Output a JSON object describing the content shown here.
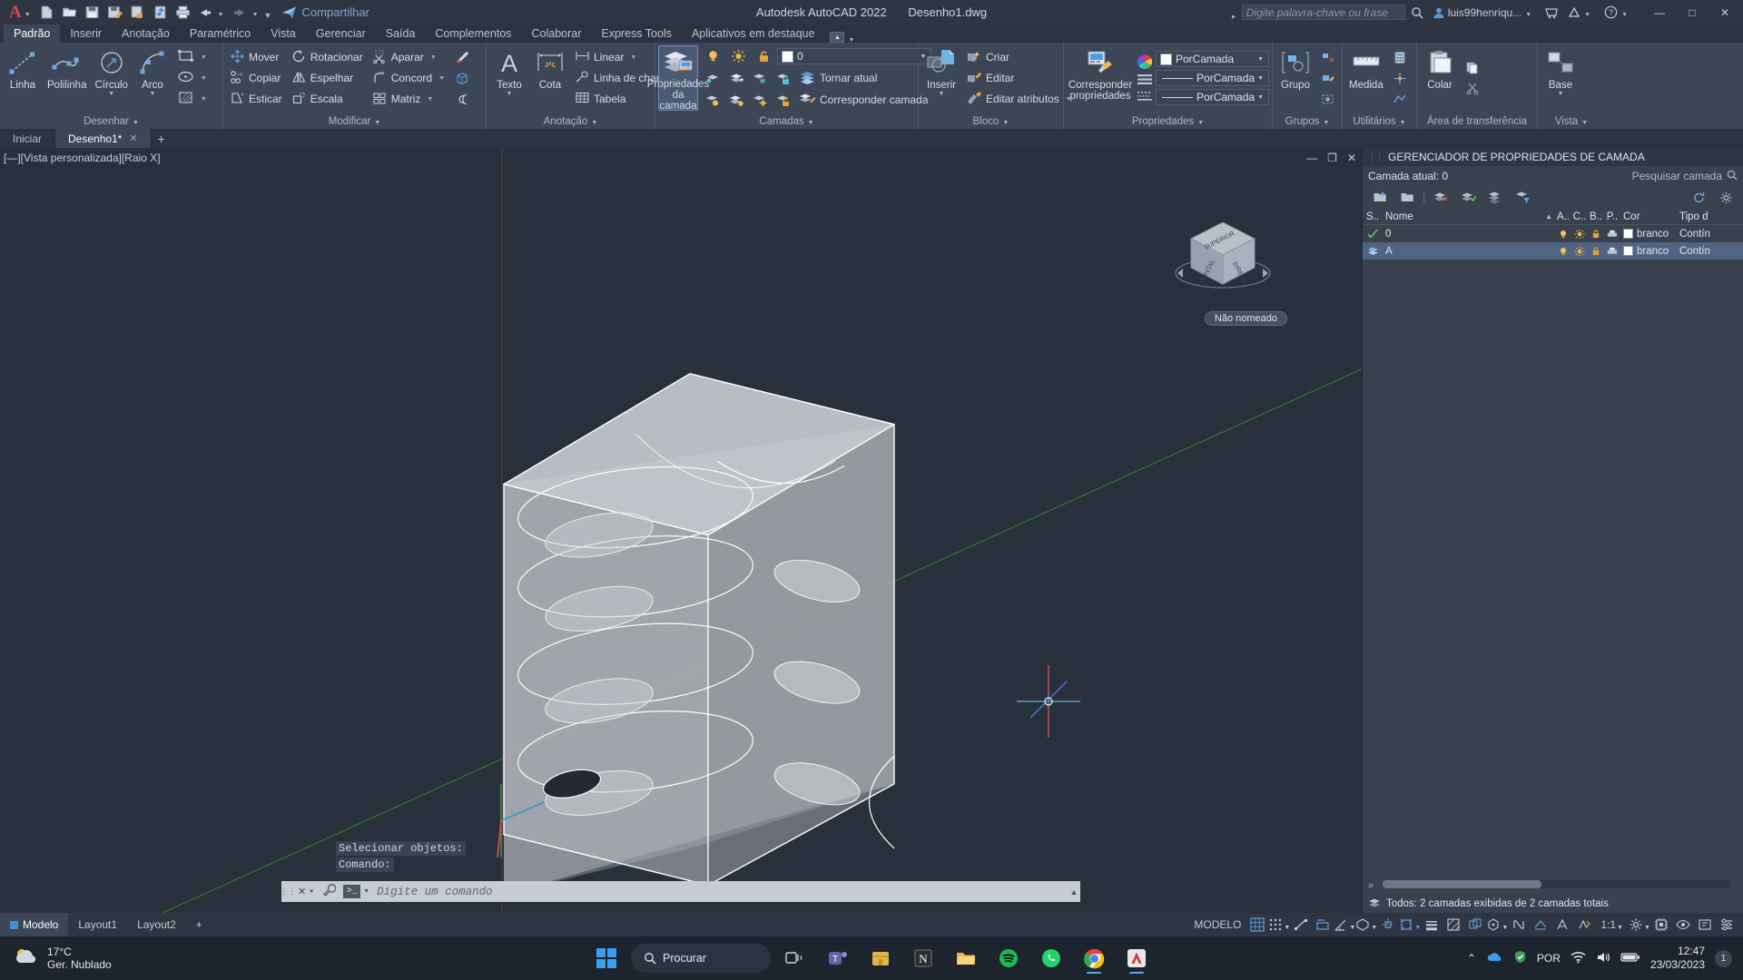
{
  "titlebar": {
    "app_menu": "A",
    "quick_access": [
      "new-icon",
      "open-icon",
      "save-icon",
      "save-as-icon",
      "plot-preview-icon",
      "sync-icon",
      "print-icon",
      "undo-icon",
      "redo-icon",
      "customize-icon"
    ],
    "share_label": "Compartilhar",
    "app_name": "Autodesk AutoCAD 2022",
    "file_name": "Desenho1.dwg",
    "search_placeholder": "Digite palavra-chave ou frase",
    "account_label": "luis99henriqu...",
    "window_buttons": {
      "minimize": "—",
      "maximize": "□",
      "close": "✕"
    }
  },
  "ribbon_tabs": [
    {
      "label": "Padrão",
      "active": true
    },
    {
      "label": "Inserir",
      "active": false
    },
    {
      "label": "Anotação",
      "active": false
    },
    {
      "label": "Paramétrico",
      "active": false
    },
    {
      "label": "Vista",
      "active": false
    },
    {
      "label": "Gerenciar",
      "active": false
    },
    {
      "label": "Saída",
      "active": false
    },
    {
      "label": "Complementos",
      "active": false
    },
    {
      "label": "Colaborar",
      "active": false
    },
    {
      "label": "Express Tools",
      "active": false
    },
    {
      "label": "Aplicativos em destaque",
      "active": false
    }
  ],
  "panels": {
    "desenhar": {
      "title": "Desenhar",
      "big": [
        {
          "label": "Linha",
          "icon": "line-icon"
        },
        {
          "label": "Polilinha",
          "icon": "polyline-icon"
        },
        {
          "label": "Círculo",
          "icon": "circle-icon",
          "dropdown": true
        },
        {
          "label": "Arco",
          "icon": "arc-icon",
          "dropdown": true
        }
      ],
      "small": [
        {
          "icon": "rectangle-icon",
          "dropdown": true
        },
        {
          "icon": "ellipse-icon",
          "dropdown": true
        },
        {
          "icon": "hatch-icon",
          "dropdown": true
        }
      ]
    },
    "modificar": {
      "title": "Modificar",
      "items": [
        {
          "label": "Mover",
          "icon": "move-icon"
        },
        {
          "label": "Rotacionar",
          "icon": "rotate-icon"
        },
        {
          "label": "Aparar",
          "icon": "trim-icon",
          "dropdown": true
        },
        {
          "label": "Copiar",
          "icon": "copy-icon"
        },
        {
          "label": "Espelhar",
          "icon": "mirror-icon"
        },
        {
          "label": "Concord",
          "icon": "fillet-icon",
          "dropdown": true
        },
        {
          "label": "Esticar",
          "icon": "stretch-icon"
        },
        {
          "label": "Escala",
          "icon": "scale-icon"
        },
        {
          "label": "Matriz",
          "icon": "array-icon",
          "dropdown": true
        }
      ],
      "icon_column": [
        "erase-icon",
        "3drotate-icon",
        "offset-icon"
      ]
    },
    "anotacao": {
      "title": "Anotação",
      "big": [
        {
          "label": "Texto",
          "icon": "text-icon",
          "dropdown": true
        },
        {
          "label": "Cota",
          "icon": "dimension-icon"
        }
      ],
      "small": [
        {
          "label": "Linear",
          "icon": "linear-dim-icon",
          "dropdown": true
        },
        {
          "label": "Linha de chamada",
          "icon": "leader-icon",
          "dropdown": true
        },
        {
          "label": "Tabela",
          "icon": "table-icon"
        }
      ]
    },
    "camadas": {
      "title": "Camadas",
      "big": {
        "label_line1": "Propriedades",
        "label_line2": "da camada",
        "icon": "layer-properties-icon",
        "selected": true
      },
      "layer_combo": {
        "value": "0",
        "color": "#ffffff"
      },
      "row_icons_1": [
        "layer-isolate-icon",
        "layer-unisolate-icon",
        "layer-freeze-icon",
        "layer-lock-icon"
      ],
      "row_icons_2": [
        "layer-off-icon",
        "layer-turn-on-icon",
        "layer-thaw-icon",
        "layer-unlock-icon"
      ],
      "small": [
        {
          "label": "Tornar atual",
          "icon": "make-current-icon"
        },
        {
          "label": "Corresponder camada",
          "icon": "match-layer-icon"
        }
      ]
    },
    "bloco": {
      "title": "Bloco",
      "big": {
        "label": "Inserir",
        "icon": "insert-block-icon",
        "dropdown": true
      },
      "small": [
        {
          "label": "Criar",
          "icon": "create-block-icon"
        },
        {
          "label": "Editar",
          "icon": "edit-block-icon"
        },
        {
          "label": "Editar atributos",
          "icon": "edit-attributes-icon",
          "dropdown": true
        }
      ]
    },
    "propriedades": {
      "title": "Propriedades",
      "big": {
        "label_line1": "Corresponder",
        "label_line2": "propriedades",
        "icon": "match-properties-icon"
      },
      "combos": [
        {
          "value": "PorCamada",
          "type": "color",
          "swatch": "#ffffff",
          "icon": "color-wheel-icon"
        },
        {
          "value": "PorCamada",
          "type": "linetype",
          "icon": "linetype-icon"
        },
        {
          "value": "PorCamada",
          "type": "lineweight",
          "icon": "lineweight-icon"
        }
      ]
    },
    "grupos": {
      "title": "Grupos",
      "big": {
        "label": "Grupo",
        "icon": "group-icon"
      },
      "icons": [
        "ungroup-icon",
        "group-edit-icon",
        "group-select-icon"
      ]
    },
    "utilitarios": {
      "title": "Utilitários",
      "big": {
        "label": "Medida",
        "icon": "measure-icon"
      },
      "icons": [
        "quick-calc-icon",
        "id-point-icon"
      ]
    },
    "area_transferencia": {
      "title": "Área de transferência",
      "big": {
        "label": "Colar",
        "icon": "paste-icon"
      },
      "icons": [
        "copy-clip-icon",
        "cut-clip-icon"
      ]
    },
    "vista": {
      "title": "Vista",
      "big": {
        "label": "Base",
        "icon": "base-view-icon"
      }
    }
  },
  "drawing_tabs": [
    {
      "label": "Iniciar",
      "active": false,
      "closable": false
    },
    {
      "label": "Desenho1*",
      "active": true,
      "closable": true
    }
  ],
  "drawing_tab_add": "+",
  "viewport": {
    "label": "[—][Vista personalizada][Raio X]",
    "viewcube_faces": [
      "SUPERIOR",
      "FRONTAL",
      "DIREITA"
    ],
    "viewcube_tooltip": "Não nomeado",
    "ucs_axes": [
      "X",
      "Y",
      "Z"
    ]
  },
  "command_line": {
    "history": [
      "Selecionar objetos:",
      "Comando:"
    ],
    "placeholder": "Digite um comando",
    "prompt_icon": "command-prompt-icon"
  },
  "layer_manager": {
    "title": "GERENCIADOR DE PROPRIEDADES DE CAMADA",
    "current_layer_label": "Camada atual: 0",
    "search_placeholder": "Pesquisar camada",
    "toolbar_left": [
      "new-layer-icon",
      "new-layer-vp-icon",
      "delete-layer-icon",
      "set-current-icon",
      "layer-states-icon",
      "layer-filter-icon"
    ],
    "toolbar_right": [
      "refresh-icon",
      "settings-icon"
    ],
    "columns": [
      "S..",
      "Nome",
      "A..",
      "C..",
      "B..",
      "P..",
      "Cor",
      "Tipo d"
    ],
    "rows": [
      {
        "status": "current",
        "name": "0",
        "color": "branco",
        "color_hex": "#ffffff",
        "linetype": "Contín",
        "selected": false
      },
      {
        "status": "layer",
        "name": "A",
        "color": "branco",
        "color_hex": "#ffffff",
        "linetype": "Contín",
        "selected": true
      }
    ],
    "status_text": "Todos: 2 camadas exibidas de 2 camadas totais",
    "expand_icon": "chevron-double-right-icon"
  },
  "status_bar": {
    "layout_tabs": [
      {
        "label": "Modelo",
        "active": true
      },
      {
        "label": "Layout1",
        "active": false
      },
      {
        "label": "Layout2",
        "active": false
      }
    ],
    "add_layout": "+",
    "model_label": "MODELO",
    "scale": "1:1",
    "right_icons": [
      "grid-display-icon",
      "snap-mode-icon",
      "ortho-mode-icon",
      "polar-tracking-icon",
      "isometric-drafting-icon",
      "object-snap-tracking-icon",
      "object-snap-icon",
      "lineweight-icon",
      "transparency-icon",
      "selection-cycling-icon",
      "3d-object-snap-icon",
      "dynamic-ucs-icon",
      "annotation-visibility-icon",
      "autoscale-icon",
      "annotation-scale-icon",
      "workspace-icon",
      "hardware-accel-icon",
      "isolate-objects-icon",
      "clean-screen-icon",
      "customization-icon"
    ]
  },
  "taskbar": {
    "weather": {
      "temp": "17°C",
      "desc": "Ger. Nublado"
    },
    "start_icon": "windows-start-icon",
    "search_label": "Procurar",
    "apps": [
      "task-view-icon",
      "teams-icon",
      "store-icon",
      "notion-icon",
      "explorer-icon",
      "spotify-icon",
      "whatsapp-icon",
      "chrome-icon",
      "autocad-icon"
    ],
    "tray": {
      "show_hidden": "chevron-up-icon",
      "icons": [
        "onedrive-icon",
        "security-icon"
      ],
      "language": "POR",
      "network": "wifi-icon",
      "volume": "volume-icon",
      "battery": "battery-icon",
      "time": "12:47",
      "date": "23/03/2023",
      "notification_count": "1"
    }
  }
}
